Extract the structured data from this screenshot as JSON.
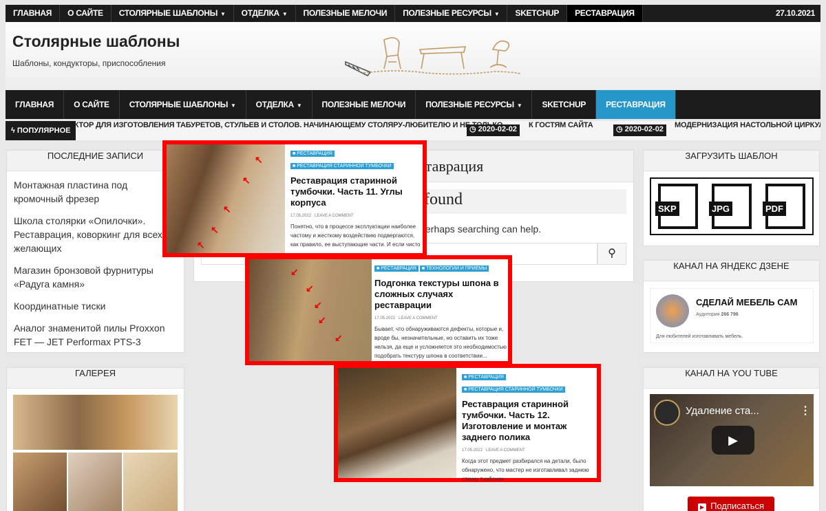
{
  "topbar": {
    "items": [
      {
        "label": "ГЛАВНАЯ"
      },
      {
        "label": "О САЙТЕ"
      },
      {
        "label": "СТОЛЯРНЫЕ ШАБЛОНЫ"
      },
      {
        "label": "ОТДЕЛКА"
      },
      {
        "label": "ПОЛЕЗНЫЕ МЕЛОЧИ"
      },
      {
        "label": "ПОЛЕЗНЫЕ РЕСУРСЫ"
      },
      {
        "label": "SKETCHUP"
      },
      {
        "label": "РЕСТАВРАЦИЯ"
      }
    ],
    "date": "27.10.2021"
  },
  "site": {
    "title": "Столярные шаблоны",
    "description": "Шаблоны, кондукторы, приспособления"
  },
  "mainnav": {
    "items": [
      {
        "label": "ГЛАВНАЯ"
      },
      {
        "label": "О САЙТЕ"
      },
      {
        "label": "СТОЛЯРНЫЕ ШАБЛОНЫ"
      },
      {
        "label": "ОТДЕЛКА"
      },
      {
        "label": "ПОЛЕЗНЫЕ МЕЛОЧИ"
      },
      {
        "label": "ПОЛЕЗНЫЕ РЕСУРСЫ"
      },
      {
        "label": "SKETCHUP"
      },
      {
        "label": "РЕСТАВРАЦИЯ"
      }
    ]
  },
  "ticker": {
    "label": "ПОПУЛЯРНОЕ",
    "text1": "УКТОР ДЛЯ ИЗГОТОВЛЕНИЯ ТАБУРЕТОВ, СТУЛЬЕВ И СТОЛОВ. НАЧИНАЮЩЕМУ СТОЛЯРУ-ЛЮБИТЕЛЮ И НЕ ТОЛЬКО",
    "date2": "2020-02-02",
    "text2": "К ГОСТЯМ САЙТА",
    "date3": "2020-02-02",
    "text3": "МОДЕРНИЗАЦИЯ НАСТОЛЬНОЙ ЦИРКУЛЯРКИ"
  },
  "recent": {
    "title": "ПОСЛЕДНИЕ ЗАПИСИ",
    "items": [
      "Монтажная пластина под кромочный фрезер",
      "Школа столярки «Опилочки». Реставрация, коворкинг для всех желающих",
      "Магазин бронзовой фурнитуры «Радуга камня»",
      "Координатные тиски",
      "Аналог знаменитой пилы Proxxon FET — JET Performax PTS-3"
    ]
  },
  "gallery": {
    "title": "ГАЛЕРЕЯ"
  },
  "main": {
    "heading_partial": "ставрация",
    "notfound_partial": "found",
    "search_hint_partial": "erhaps searching can help."
  },
  "upload": {
    "title": "ЗАГРУЗИТЬ ШАБЛОН",
    "formats": [
      "SKP",
      "JPG",
      "PDF"
    ]
  },
  "dzen": {
    "title": "КАНАЛ НА ЯНДЕКС ДЗЕНЕ",
    "name": "СДЕЛАЙ МЕБЕЛЬ САМ",
    "audience_label": "Аудитория",
    "audience": "266 796",
    "tagline": "Для любителей изготавливать мебель."
  },
  "youtube": {
    "title": "КАНАЛ НА YOU TUBE",
    "video_title": "Удаление ста...",
    "subscribe": "Подписаться"
  },
  "cards": [
    {
      "cats": [
        "РЕСТАВРАЦИЯ",
        "РЕСТАВРАЦИЯ СТАРИННОЙ ТУМБОЧКИ"
      ],
      "title": "Реставрация старинной тумбочки. Часть 11. Углы корпуса",
      "date": "17.05.2022",
      "comment": "LEAVE A COMMENT",
      "excerpt": "Понятно, что в процессе эксплуатации наиболее частому и жесткому воздействию подвергаются, как правило, ее выступающие части. И если чисто"
    },
    {
      "cats": [
        "РЕСТАВРАЦИЯ",
        "ТЕХНОЛОГИИ И ПРИЕМЫ"
      ],
      "title": "Подгонка текстуры шпона в сложных случаях реставрации",
      "date": "17.05.2022",
      "comment": "LEAVE A COMMENT",
      "excerpt": "Бывает, что обнаруживаются дефекты, которые и, вроде бы, незначительные, но оставить их тоже нельзя, да еще и усложняется это необходимостью подобрать текстуру шпона в соответствии..."
    },
    {
      "cats": [
        "РЕСТАВРАЦИЯ",
        "РЕСТАВРАЦИЯ СТАРИННОЙ ТУМБОЧКИ"
      ],
      "title": "Реставрация старинной тумбочки. Часть 12. Изготовление и монтаж заднего полика",
      "date": "17.05.2022",
      "comment": "LEAVE A COMMENT",
      "excerpt": "Когда этот предмет разбирался на детали, было обнаружено, что мастер не изготавливал заднюю стенку тумбочки"
    }
  ]
}
